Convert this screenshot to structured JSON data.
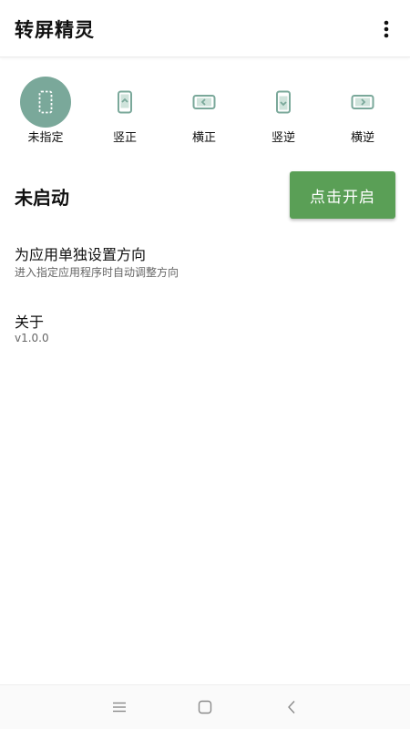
{
  "app": {
    "title": "转屏精灵"
  },
  "colors": {
    "accent": "#7aa89a",
    "button": "#5a9f56",
    "icon": "#7aa89a"
  },
  "modes": [
    {
      "label": "未指定",
      "icon": "rect-dashed-icon",
      "active": true
    },
    {
      "label": "竖正",
      "icon": "portrait-icon",
      "active": false
    },
    {
      "label": "横正",
      "icon": "landscape-icon",
      "active": false
    },
    {
      "label": "竖逆",
      "icon": "portrait-reverse-icon",
      "active": false
    },
    {
      "label": "横逆",
      "icon": "landscape-reverse-icon",
      "active": false
    }
  ],
  "status": {
    "text": "未启动",
    "button_label": "点击开启"
  },
  "settings": {
    "per_app": {
      "title": "为应用单独设置方向",
      "subtitle": "进入指定应用程序时自动调整方向"
    },
    "about": {
      "title": "关于",
      "version": "v1.0.0"
    }
  },
  "navbar": {
    "menu_icon": "menu-icon",
    "home_icon": "home-icon",
    "back_icon": "back-icon"
  }
}
